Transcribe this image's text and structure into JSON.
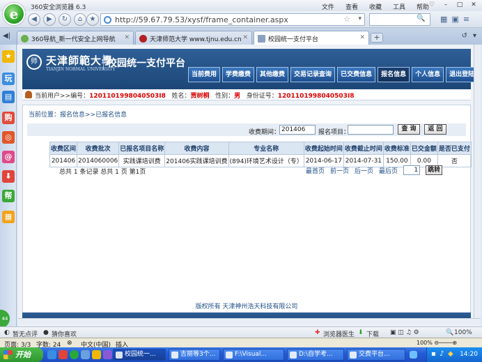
{
  "browser": {
    "title": "360安全浏览器 6.3",
    "logo": "e",
    "menu": [
      "文件",
      "查看",
      "收藏",
      "工具",
      "帮助"
    ],
    "url": "http://59.67.79.53/xysf/frame_container.aspx",
    "tabs": [
      {
        "label": "360导航_新一代安全上网导航",
        "icon_color": "#6ab04c",
        "active": false
      },
      {
        "label": "天津师范大学 www.tjnu.edu.cn",
        "icon_color": "#b22222",
        "active": false
      },
      {
        "label": "校园统一支付平台",
        "icon_color": "#8aa0c0",
        "active": true
      }
    ],
    "tab_new_label": "+",
    "sidebar_icons": [
      {
        "name": "favorites-star-icon",
        "glyph": "★",
        "color": "#f2b705"
      },
      {
        "name": "play-icon",
        "glyph": "玩",
        "color": "#3a8de0"
      },
      {
        "name": "book-icon",
        "glyph": "▤",
        "color": "#2f7fd6"
      },
      {
        "name": "shopping-icon",
        "glyph": "购",
        "color": "#e24b3b"
      },
      {
        "name": "weibo-icon",
        "glyph": "◎",
        "color": "#e0562b"
      },
      {
        "name": "email-icon",
        "glyph": "@",
        "color": "#e04a8a"
      },
      {
        "name": "download-icon",
        "glyph": "⬇",
        "color": "#e0443a"
      },
      {
        "name": "help-icon",
        "glyph": "帮",
        "color": "#3aa83a"
      },
      {
        "name": "app-icon",
        "glyph": "▦",
        "color": "#f2a31b"
      }
    ],
    "side_bubble": "44"
  },
  "site": {
    "logo_glyph": "师",
    "university": "天津師範大學",
    "university_en": "TIANJIN NORMAL UNIVERSITY",
    "title": "校园统一支付平台",
    "nav": [
      {
        "label": "当前费用",
        "active": false
      },
      {
        "label": "学费缴费",
        "active": false
      },
      {
        "label": "其他缴费",
        "active": false
      },
      {
        "label": "交易记录查询",
        "active": false
      },
      {
        "label": "已交费信息",
        "active": false
      },
      {
        "label": "报名信息",
        "active": true
      },
      {
        "label": "个人信息",
        "active": false
      },
      {
        "label": "退出登陆",
        "active": false
      }
    ],
    "user": {
      "prefix": "当前用户>>编号：",
      "id": "1201101998040503I8",
      "name_label": "姓名：",
      "name": "贾树桐",
      "gender_label": "性别：",
      "gender": "男",
      "idcard_label": "身份证号：",
      "idcard": "1201101998040503I8"
    },
    "breadcrumb": "当前位置：报名信息>>已报名信息",
    "filters": {
      "period_label": "收费期间：",
      "period_value": "201406",
      "item_label": "报名项目：",
      "item_value": "",
      "query_button": "查 询",
      "back_button": "返 回"
    },
    "table": {
      "headers": [
        "收费区间",
        "收费批次",
        "已报名项目名称",
        "收费内容",
        "专业名称",
        "收费起始时间",
        "收费截止时间",
        "收费标准",
        "已交金额",
        "是否已支付"
      ],
      "rows": [
        [
          "201406",
          "2014060006",
          "实践课培训费",
          "201406实践课培训费",
          "(894)环境艺术设计（专）",
          "2014-06-17",
          "2014-07-31",
          "150.00",
          "0.00",
          "否"
        ]
      ]
    },
    "summary": "总共 1 条记录     总共 1 页    第1页",
    "pager": {
      "first": "最首页",
      "prev": "前一页",
      "next": "后一页",
      "last": "最后页",
      "page_value": "1",
      "jump": "跳转"
    },
    "footer": "版权所有 天津神州浩天科技有限公司"
  },
  "statusbar": {
    "left1": "暂无点评",
    "left2": "猜你喜欢",
    "doctor": "浏览器医生",
    "download": "下载",
    "zoom": "100%"
  },
  "office": {
    "page": "页面: 3/3",
    "words": "字数: 24",
    "lang": "中文(中国)",
    "mode": "插入"
  },
  "taskbar": {
    "start": "开始",
    "buttons": [
      {
        "label": "校园统一...",
        "active": true
      },
      {
        "label": "吉丽等3个...",
        "active": false
      },
      {
        "label": "F:\\Visual...",
        "active": false
      },
      {
        "label": "D:\\自学考...",
        "active": false
      },
      {
        "label": "交费平台...",
        "active": false
      }
    ],
    "clock": "14:20"
  }
}
